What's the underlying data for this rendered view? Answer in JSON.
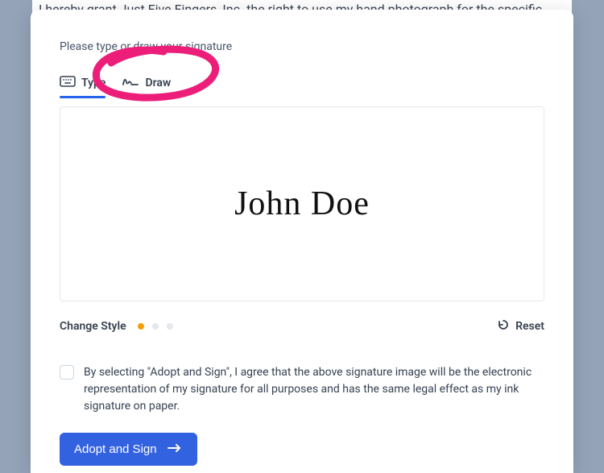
{
  "background": {
    "snippet": "I hereby grant Just Five Fingers, Inc. the right to use my hand photograph for the specific"
  },
  "modal": {
    "instruction": "Please type or draw your signature",
    "tabs": {
      "type": {
        "label": "Type",
        "active": true
      },
      "draw": {
        "label": "Draw",
        "active": false
      }
    },
    "signature": "John Doe",
    "style": {
      "label": "Change Style",
      "active_index": 0,
      "count": 3
    },
    "reset_label": "Reset",
    "consent_text": "By selecting \"Adopt and Sign\", I agree that the above signature image will be the electronic representation of my signature for all purposes and has the same legal effect as my ink signature on paper.",
    "consent_checked": false,
    "adopt_label": "Adopt and Sign"
  }
}
